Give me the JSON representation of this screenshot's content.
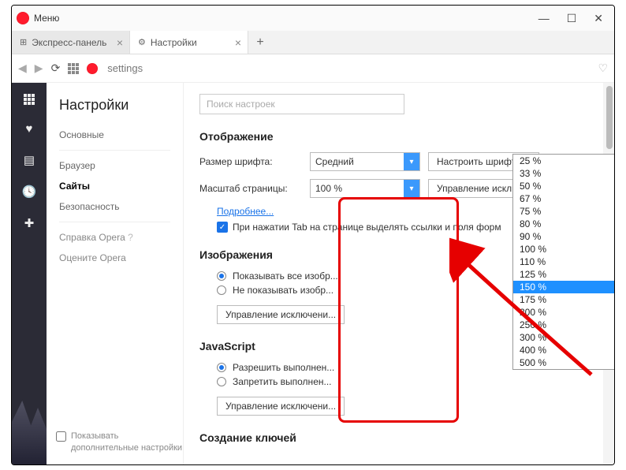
{
  "titlebar": {
    "menu": "Меню"
  },
  "tabs": [
    {
      "label": "Экспресс-панель",
      "active": false
    },
    {
      "label": "Настройки",
      "active": true
    }
  ],
  "url": "settings",
  "sidebar": {
    "title": "Настройки",
    "items": [
      "Основные",
      "Браузер",
      "Сайты",
      "Безопасность"
    ],
    "help": "Справка Opera",
    "rate": "Оцените Opera",
    "show_adv": "Показывать дополнительные настройки"
  },
  "search_placeholder": "Поиск настроек",
  "sections": {
    "display": "Отображение",
    "font_size_label": "Размер шрифта:",
    "font_size_value": "Средний",
    "configure_fonts": "Настроить шрифты...",
    "page_zoom_label": "Масштаб страницы:",
    "page_zoom_value": "100 %",
    "manage_exc": "Управление исключениями...",
    "more": "Подробнее...",
    "tab_checkbox": "При нажатии Tab на странице выделять ссылки и поля форм",
    "images": "Изображения",
    "img_show": "Показывать все изобр...",
    "img_hide": "Не показывать изобр...",
    "manage_exc2": "Управление исключени...",
    "js": "JavaScript",
    "js_allow": "Разрешить выполнен...",
    "js_deny": "Запретить выполнен...",
    "manage_exc3": "Управление исключени...",
    "keys": "Создание ключей"
  },
  "zoom_options": [
    "25 %",
    "33 %",
    "50 %",
    "67 %",
    "75 %",
    "80 %",
    "90 %",
    "100 %",
    "110 %",
    "125 %",
    "150 %",
    "175 %",
    "200 %",
    "250 %",
    "300 %",
    "400 %",
    "500 %"
  ],
  "zoom_selected": "150 %"
}
